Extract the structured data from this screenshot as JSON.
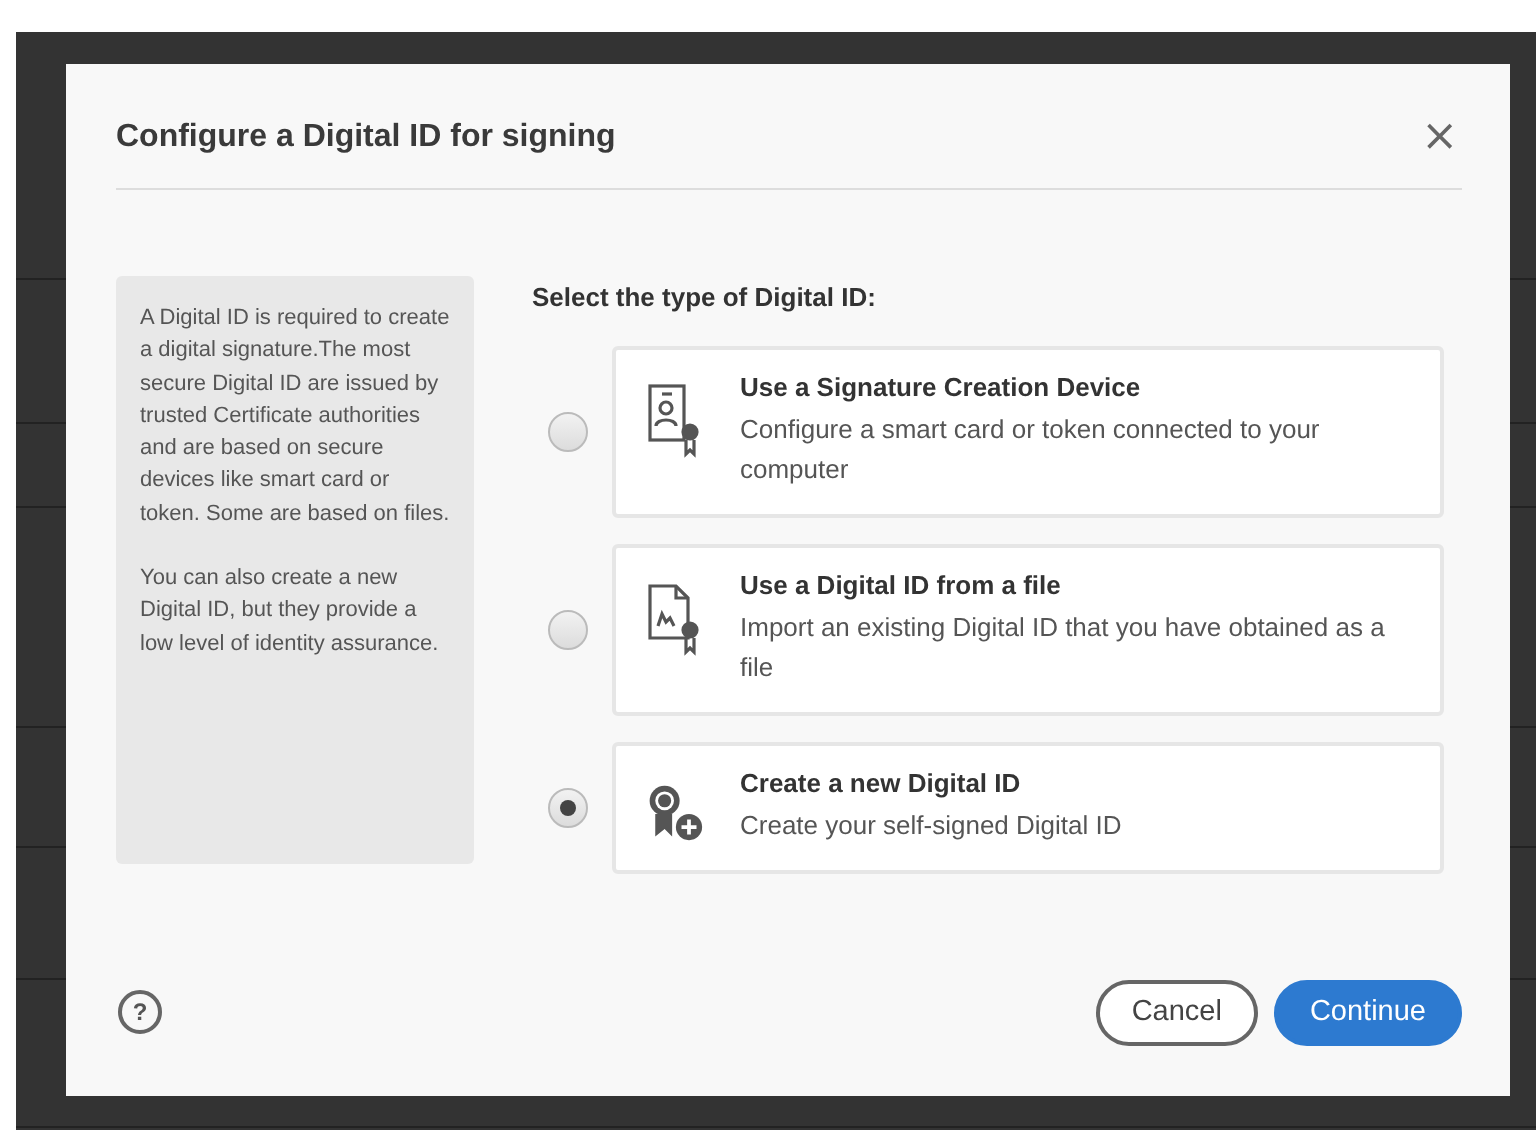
{
  "dialog": {
    "title": "Configure a Digital ID for signing",
    "close": "×",
    "info": [
      "A Digital ID is required to create a digital signature.The most secure Digital ID are issued by trusted Certificate authorities and are based on secure devices like smart card or token. Some are based on files.",
      "You can also create a new Digital ID, but they provide a low level of identity assurance."
    ],
    "prompt": "Select the type of Digital ID:",
    "options": [
      {
        "kind": "device",
        "title": "Use a Signature Creation Device",
        "description": "Configure a smart card or token connected to your computer",
        "selected": false
      },
      {
        "kind": "file",
        "title": "Use a Digital ID from a file",
        "description": "Import an existing Digital ID that you have obtained as a file",
        "selected": false
      },
      {
        "kind": "new",
        "title": "Create a new Digital ID",
        "description": "Create your self-signed Digital ID",
        "selected": true
      }
    ],
    "help": "?",
    "buttons": [
      {
        "kind": "secondary",
        "label": "Cancel"
      },
      {
        "kind": "primary",
        "label": "Continue"
      }
    ]
  }
}
